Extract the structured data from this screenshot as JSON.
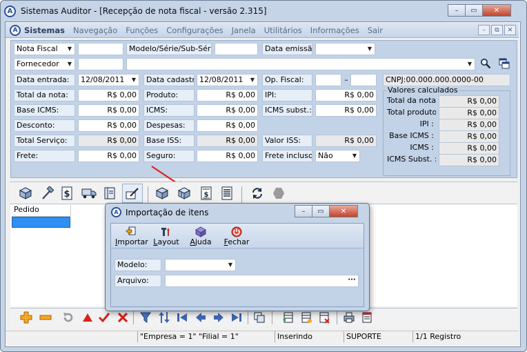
{
  "window": {
    "title": "Sistemas Auditor - [Recepção de nota fiscal - versão 2.315]",
    "logo_letter": "A",
    "minimize": "–",
    "maximize": "▭",
    "close": "✕"
  },
  "menubar": {
    "items": [
      "Sistemas",
      "Navegação",
      "Funções",
      "Configurações",
      "Janela",
      "Utilitários",
      "Informações",
      "Sair"
    ],
    "mdi_min": "–",
    "mdi_restore": "⧉",
    "mdi_close": "✕"
  },
  "form": {
    "doc_type": "Nota Fiscal",
    "doc_type_value": "",
    "modelo_label": "Modelo/Série/Sub-Série:",
    "modelo_value": "",
    "data_emissao_label": "Data emissão:",
    "data_emissao_value": "",
    "fornecedor_label": "Fornecedor",
    "fornecedor_code": "",
    "fornecedor_name": "",
    "data_entrada_label": "Data entrada:",
    "data_entrada_value": "12/08/2011",
    "data_cadastro_label": "Data cadastro:",
    "data_cadastro_value": "12/08/2011",
    "op_fiscal_label": "Op. Fiscal:",
    "op_fiscal_dash": "–",
    "cnpj": "CNPJ:00.000.000.0000-00",
    "total_nota_label": "Total da nota:",
    "total_nota_value": "R$ 0,00",
    "produto_label": "Produto:",
    "produto_value": "R$ 0,00",
    "ipi_label": "IPI:",
    "ipi_value": "R$ 0,00",
    "base_icms_label": "Base ICMS:",
    "base_icms_value": "R$ 0,00",
    "icms_label": "ICMS:",
    "icms_value": "R$ 0,00",
    "icms_subst_label": "ICMS subst.:",
    "icms_subst_value": "R$ 0,00",
    "desconto_label": "Desconto:",
    "desconto_value": "R$ 0,00",
    "despesas_label": "Despesas:",
    "despesas_value": "R$ 0,00",
    "total_servico_label": "Total Serviço:",
    "total_servico_value": "R$ 0,00",
    "base_iss_label": "Base ISS:",
    "base_iss_value": "R$ 0,00",
    "valor_iss_label": "Valor ISS:",
    "valor_iss_value": "R$ 0,00",
    "frete_label": "Frete:",
    "frete_value": "R$ 0,00",
    "seguro_label": "Seguro:",
    "seguro_value": "R$ 0,00",
    "frete_incluso_label": "Frete incluso:",
    "frete_incluso_value": "Não"
  },
  "calc": {
    "group_title": "Valores calculados",
    "rows": [
      {
        "label": "Total da nota :",
        "value": "R$ 0,00"
      },
      {
        "label": "Total produto :",
        "value": "R$ 0,00"
      },
      {
        "label": "IPI :",
        "value": "R$ 0,00"
      },
      {
        "label": "Base ICMS :",
        "value": "R$ 0,00"
      },
      {
        "label": "ICMS :",
        "value": "R$ 0,00"
      },
      {
        "label": "ICMS Subst. :",
        "value": "R$ 0,00"
      }
    ]
  },
  "grid": {
    "column": "Pedido"
  },
  "dialog": {
    "title": "Importação de itens",
    "importar": "Importar",
    "layout": "Layout",
    "ajuda": "Ajuda",
    "fechar": "Fechar",
    "modelo_label": "Modelo:",
    "modelo_value": "",
    "arquivo_label": "Arquivo:",
    "arquivo_value": "",
    "browse": "···",
    "min": "–",
    "max": "▭",
    "close": "✕"
  },
  "status": {
    "empresa": "\"Empresa = 1\"  \"Filial = 1\"",
    "mode": "Inserindo",
    "user": "SUPORTE",
    "registro": "1/1 Registro"
  },
  "colors": {
    "accent": "#2f8ff2",
    "panel": "#c2d2e7",
    "close_red": "#c2432a",
    "arrow_red": "#e0201a"
  }
}
